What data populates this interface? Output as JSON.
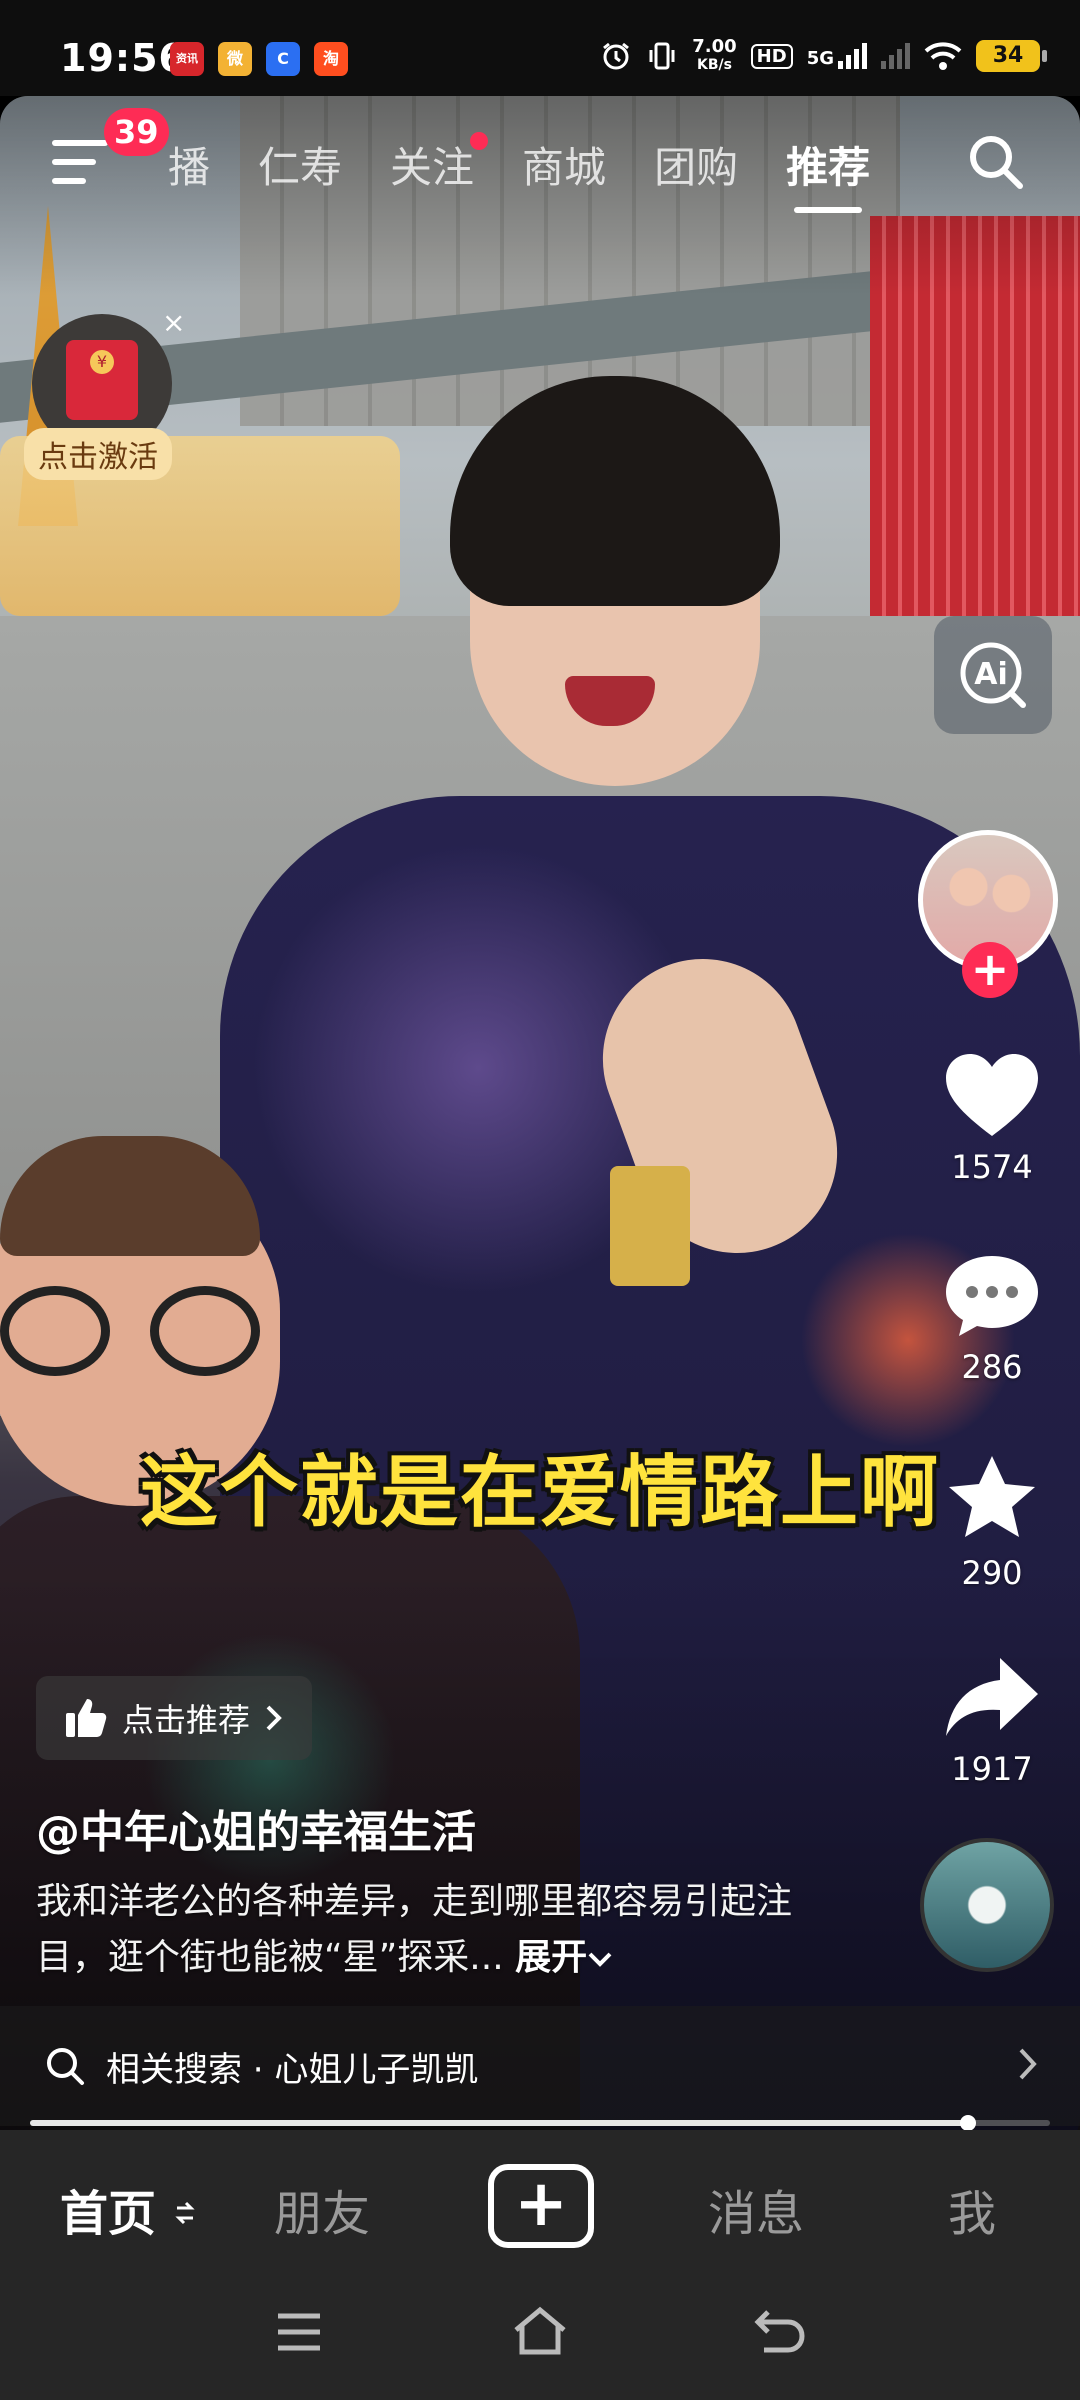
{
  "status_bar": {
    "time": "19:56",
    "app_icons": [
      {
        "name": "news-app-icon",
        "text": "资讯",
        "bg": "#d7262b"
      },
      {
        "name": "weibo-app-icon",
        "text": "微",
        "bg": "#f3b234"
      },
      {
        "name": "browser-app-icon",
        "text": "C",
        "bg": "#2b6ff2"
      },
      {
        "name": "taobao-app-icon",
        "text": "淘",
        "bg": "#ff4e1f"
      }
    ],
    "net_speed_value": "7.00",
    "net_speed_unit": "KB/s",
    "hd_label": "HD",
    "network_label": "5G",
    "battery_level": "34"
  },
  "top_nav": {
    "notification_count": "39",
    "tabs": [
      {
        "label": "播",
        "active": false,
        "dot": false
      },
      {
        "label": "仁寿",
        "active": false,
        "dot": false
      },
      {
        "label": "关注",
        "active": false,
        "dot": true
      },
      {
        "label": "商城",
        "active": false,
        "dot": false
      },
      {
        "label": "团购",
        "active": false,
        "dot": false
      },
      {
        "label": "推荐",
        "active": true,
        "dot": false
      }
    ]
  },
  "red_packet": {
    "label": "点击激活",
    "close": "×"
  },
  "right_rail": {
    "likes": "1574",
    "comments": "286",
    "favorites": "290",
    "shares": "1917",
    "follow_symbol": "+",
    "ai_label": "Ai"
  },
  "video": {
    "subtitle": "这个就是在爱情路上啊",
    "recommend_label": "点击推荐",
    "author": "@中年心姐的幸福生活",
    "caption": "我和洋老公的各种差异，走到哪里都容易引起注目，逛个街也能被“星”探采...",
    "expand_label": "展开",
    "progress": 0.92
  },
  "related_search": {
    "text": "相关搜索 · 心姐儿子凯凯"
  },
  "bottom_tabs": [
    {
      "label": "首页",
      "active": true
    },
    {
      "label": "朋友",
      "active": false
    },
    {
      "label": "消息",
      "active": false
    },
    {
      "label": "我",
      "active": false
    }
  ],
  "colors": {
    "accent": "#fe2c55",
    "subtitle": "#ffe33d",
    "tabbar_bg": "#262626"
  }
}
